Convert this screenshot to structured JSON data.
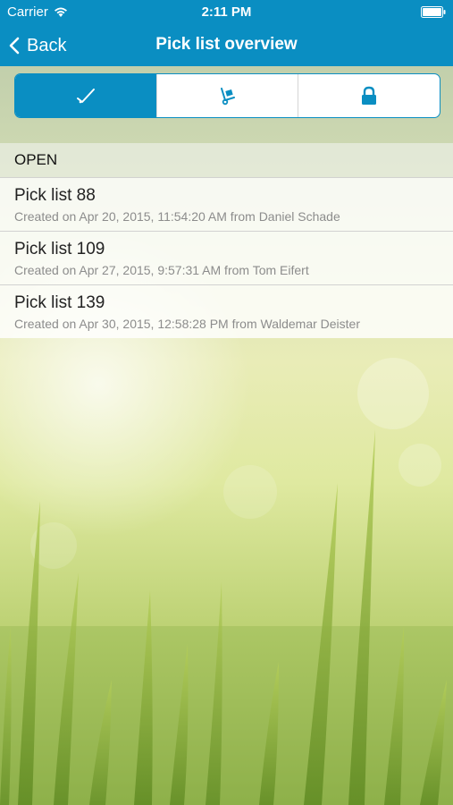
{
  "status_bar": {
    "carrier": "Carrier",
    "time": "2:11 PM"
  },
  "nav": {
    "back_label": "Back",
    "title": "Pick list overview"
  },
  "segments": [
    {
      "icon": "check-icon",
      "selected": true
    },
    {
      "icon": "hand-truck-icon",
      "selected": false
    },
    {
      "icon": "lock-icon",
      "selected": false
    }
  ],
  "section": {
    "title": "OPEN"
  },
  "pick_lists": [
    {
      "title": "Pick list 88",
      "subtitle": "Created on Apr 20, 2015, 11:54:20 AM from Daniel Schade"
    },
    {
      "title": "Pick list 109",
      "subtitle": "Created on Apr 27, 2015, 9:57:31 AM from Tom Eifert"
    },
    {
      "title": "Pick list 139",
      "subtitle": "Created on Apr 30, 2015, 12:58:28 PM from Waldemar Deister"
    }
  ],
  "colors": {
    "accent": "#0a8ec2",
    "list_background": "#ffffff",
    "subtitle_text": "#8c8c8c"
  }
}
